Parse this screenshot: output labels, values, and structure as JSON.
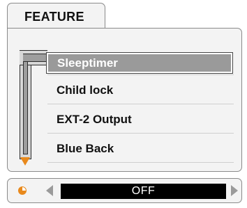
{
  "tab": {
    "label": "FEATURE"
  },
  "menu": {
    "items": [
      {
        "label": "Sleeptimer",
        "selected": true
      },
      {
        "label": "Child lock",
        "selected": false
      },
      {
        "label": "EXT-2 Output",
        "selected": false
      },
      {
        "label": "Blue Back",
        "selected": false
      }
    ]
  },
  "setting": {
    "value": "OFF"
  },
  "icons": {
    "scroll": "down-arrow-icon",
    "setting": "clock-pie-icon",
    "prev": "left-arrow-icon",
    "next": "right-arrow-icon"
  },
  "colors": {
    "accent": "#e8891c",
    "panel": "#f3f3f3",
    "selection": "#9a9a9a",
    "value_bg": "#000000"
  }
}
